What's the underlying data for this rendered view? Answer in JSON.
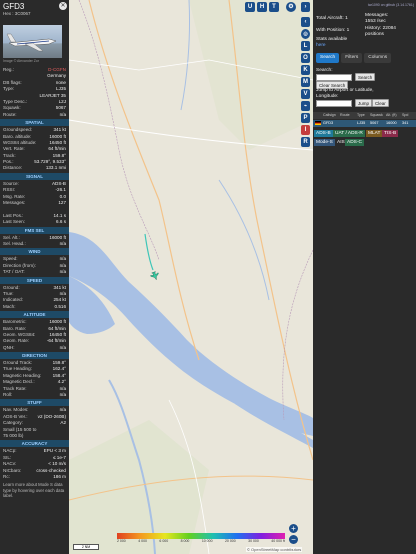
{
  "aircraft": {
    "callsign": "GFD3",
    "hex_label": "Hex :",
    "hex": "3C0067",
    "photo_credit": "Image © Alexander Zor",
    "close_icon": "close-icon"
  },
  "details": [
    {
      "k": "Reg.:",
      "v": "D-CGFN",
      "link": true
    },
    {
      "k": "",
      "v": "Germany"
    },
    {
      "k": "DB flags:",
      "v": "none"
    },
    {
      "k": "Type:",
      "v": "LJ35"
    },
    {
      "k": "",
      "v": "LEARJET 35"
    },
    {
      "k": "Type Desc.:",
      "v": "L2J"
    },
    {
      "k": "Squawk:",
      "v": "5067"
    },
    {
      "k": "Route:",
      "v": "n/a"
    }
  ],
  "sections": [
    {
      "title": "SPATIAL",
      "rows": [
        {
          "k": "Groundspeed:",
          "v": "341 kt"
        },
        {
          "k": "Baro. altitude:",
          "v": "16000 ft"
        },
        {
          "k": "WGS84 altitude:",
          "v": "16450 ft"
        },
        {
          "k": "Vert. Rate:",
          "v": "64 ft/min"
        },
        {
          "k": "Track:",
          "v": "159.8°"
        },
        {
          "k": "Pos.:",
          "v": "53.729°, 9.533°"
        },
        {
          "k": "Distance:",
          "v": "133.1 nmi"
        }
      ]
    },
    {
      "title": "SIGNAL",
      "rows": [
        {
          "k": "Source:",
          "v": "ADS-B"
        },
        {
          "k": "RSSI:",
          "v": "-26.1"
        },
        {
          "k": "Msg. Rate:",
          "v": "0.0"
        },
        {
          "k": "Messages:",
          "v": "127"
        },
        {
          "k": "",
          "v": ""
        },
        {
          "k": "Last Pos.:",
          "v": "14.1 s"
        },
        {
          "k": "Last Seen:",
          "v": "6.6 s"
        }
      ]
    },
    {
      "title": "FMS SEL",
      "rows": [
        {
          "k": "Sel. Alt.:",
          "v": "16000 ft"
        },
        {
          "k": "Sel. Head.:",
          "v": "n/a"
        }
      ]
    },
    {
      "title": "WIND",
      "rows": [
        {
          "k": "Speed:",
          "v": "n/a"
        },
        {
          "k": "Direction (from):",
          "v": "n/a"
        },
        {
          "k": "TAT / OAT:",
          "v": "n/a"
        }
      ]
    },
    {
      "title": "SPEED",
      "rows": [
        {
          "k": "Ground:",
          "v": "341 kt"
        },
        {
          "k": "True:",
          "v": "n/a"
        },
        {
          "k": "Indicated:",
          "v": "254 kt"
        },
        {
          "k": "Mach:",
          "v": "0.516"
        }
      ]
    },
    {
      "title": "ALTITUDE",
      "rows": [
        {
          "k": "Barometric:",
          "v": "16000 ft"
        },
        {
          "k": "Baro. Rate:",
          "v": "64 ft/min"
        },
        {
          "k": "Geom. WGS84:",
          "v": "16450 ft"
        },
        {
          "k": "Geom. Rate:",
          "v": "-64 ft/min"
        },
        {
          "k": "QNH:",
          "v": "n/a"
        }
      ]
    },
    {
      "title": "DIRECTION",
      "rows": [
        {
          "k": "Ground Track:",
          "v": "159.8°"
        },
        {
          "k": "True Heading:",
          "v": "162.4°"
        },
        {
          "k": "Magnetic Heading:",
          "v": "158.4°"
        },
        {
          "k": "Magnetic Decl.:",
          "v": "4.2°"
        },
        {
          "k": "Track Rate:",
          "v": "n/a"
        },
        {
          "k": "Roll:",
          "v": "n/a"
        }
      ]
    },
    {
      "title": "STUFF",
      "rows": [
        {
          "k": "Nav. Modes:",
          "v": "n/a"
        },
        {
          "k": "ADS-B Ver.:",
          "v": "v2 (DO-260B)"
        },
        {
          "k": "Category:",
          "v": "A2"
        },
        {
          "k": "Small (15 500 to",
          "v": ""
        },
        {
          "k": "75 000 lb)",
          "v": ""
        }
      ]
    },
    {
      "title": "ACCURACY",
      "rows": [
        {
          "k": "NACp:",
          "v": "EPU < 3 m"
        },
        {
          "k": "SIL:",
          "v": "≤ 1e-7"
        },
        {
          "k": "NACv:",
          "v": "< 10 m/s"
        },
        {
          "k": "NICbaro:",
          "v": "cross-checked"
        },
        {
          "k": "Rc:",
          "v": "186 m"
        }
      ]
    }
  ],
  "footer_text": "Learn more about Mode S data type by hovering over each data label.",
  "map": {
    "top_buttons": [
      "U",
      "H",
      "T"
    ],
    "side_buttons": [
      "L",
      "O",
      "K",
      "M",
      "V",
      "P",
      "I",
      "R"
    ],
    "zoom_in": "+",
    "zoom_out": "−",
    "altitude_legend": [
      "2 000",
      "4 000",
      "6 000",
      "8 000",
      "10 000",
      "20 000",
      "30 000",
      "40 000 ft"
    ],
    "scale_label": "2 NM",
    "attribution": "© OpenStreetMap contributors",
    "colors": {
      "water": "#a8c0e4",
      "land": "#e9e6da",
      "aircraft": "#34c9a0",
      "track": "#3fc6b8"
    }
  },
  "stats": {
    "github_link": "tar1090 on github (3.14.1761)",
    "total_aircraft_label": "Total Aircraft:",
    "total_aircraft": "1",
    "with_position_label": "With Position:",
    "with_position": "1",
    "messages_label": "Messages:",
    "messages": "1553 /sec",
    "history_label": "History:",
    "history": "22084 positions",
    "stats_available": "Stats available",
    "stats_link": "here"
  },
  "tabs": [
    "Search",
    "Filters",
    "Columns"
  ],
  "search": {
    "label": "Search:",
    "search_button": "Search",
    "clear_button": "Clear Search",
    "jump_label": "Jump to Airport or Latitude, Longitude:",
    "jump_button": "Jump",
    "clear_jump_button": "Clear"
  },
  "table": {
    "headers": [
      "",
      "Callsign",
      "Route",
      "Type",
      "Squawk",
      "Alt. (ft)",
      "Spd"
    ],
    "rows": [
      {
        "callsign": "GFD3",
        "route": "",
        "type": "LJ35",
        "squawk": "5067",
        "alt": "16000",
        "spd": "341"
      }
    ]
  },
  "sources": [
    {
      "label": "ADS-B",
      "color": "#1f7a9a"
    },
    {
      "label": "UAT / ADS-R",
      "color": "#2a6b4a"
    },
    {
      "label": "MLAT",
      "color": "#7a5a20"
    },
    {
      "label": "TIS-B",
      "color": "#8a2a4a"
    },
    {
      "label": "Mode-S",
      "color": "#34567a"
    },
    {
      "label": "AIS",
      "color": "#2a2a2a"
    },
    {
      "label": "ADS-C",
      "color": "#2a6b4a"
    }
  ]
}
